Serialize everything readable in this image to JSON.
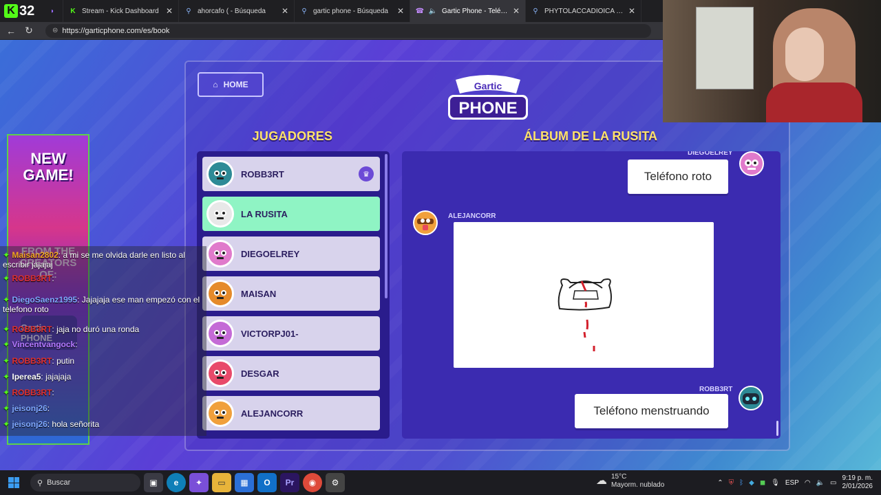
{
  "browser": {
    "kick_count": "32",
    "tabs": [
      {
        "title": "",
        "icon": "kick-icon",
        "closable": false
      },
      {
        "title": "Stream - Kick Dashboard",
        "icon": "kick-icon"
      },
      {
        "title": "ahorcafo ( - Búsqueda",
        "icon": "search-icon"
      },
      {
        "title": "gartic phone - Búsqueda",
        "icon": "search-icon"
      },
      {
        "title": "Gartic Phone - Teléfono De",
        "icon": "gartic-icon",
        "active": true
      },
      {
        "title": "PHYTOLACCADIOICA - Búsque",
        "icon": "search-icon"
      }
    ],
    "url": "https://garticphone.com/es/book"
  },
  "game": {
    "home_label": "HOME",
    "logo_line1": "Gartic",
    "logo_line2": "PHONE",
    "players_title": "JUGADORES",
    "album_title": "ÁLBUM DE LA RUSITA",
    "players": [
      {
        "name": "ROBB3RT",
        "host": true,
        "avatar_color": "#2d8a96"
      },
      {
        "name": "LA RUSITA",
        "me": true,
        "avatar_color": "#e8e8e8"
      },
      {
        "name": "DIEGOELREY",
        "avatar_color": "#e07acb"
      },
      {
        "name": "MAISAN",
        "avatar_color": "#e58a2a"
      },
      {
        "name": "VICTORPJ01-",
        "avatar_color": "#c46ad6"
      },
      {
        "name": "DESGAR",
        "avatar_color": "#e84a6a"
      },
      {
        "name": "ALEJANCORR",
        "avatar_color": "#f0a03c"
      }
    ],
    "album": {
      "entry1_user": "DIEGOELREY",
      "entry1_text": "Teléfono roto",
      "entry2_user": "ALEJANCORR",
      "entry3_user": "ROBB3RT",
      "entry3_text": "Teléfono menstruando"
    }
  },
  "chat": [
    {
      "user": "Maisan2802",
      "text": ": a mi se me olvida darle en listo al escribir jajajaj",
      "color": "#f5a623"
    },
    {
      "user": "ROBB3RT",
      "text": ":",
      "color": "#e03030"
    },
    {
      "user": "DiegoSaenz1995",
      "text": ": Jajajaja ese man empezó con el telefono roto",
      "color": "#7fa8ff"
    },
    {
      "user": "ROBB3RT",
      "text": ": jaja no duró una ronda",
      "color": "#e03030"
    },
    {
      "user": "Vincentvangock",
      "text": ":",
      "color": "#b478ff"
    },
    {
      "user": "ROBB3RT",
      "text": ": putin",
      "color": "#e03030"
    },
    {
      "user": "Iperea5",
      "text": ": jajajaja",
      "color": "#ffffff"
    },
    {
      "user": "ROBB3RT",
      "text": ":",
      "color": "#e03030"
    },
    {
      "user": "jeisonj26",
      "text": ":",
      "color": "#7fa8ff"
    },
    {
      "user": "jeisonj26",
      "text": ": hola señorita",
      "color": "#7fa8ff"
    }
  ],
  "promo": {
    "line1": "NEW",
    "line2": "GAME!",
    "line3": "FROM THE",
    "line4": "CREATORS",
    "line5": "OF:",
    "brand": "Gartic PHONE"
  },
  "taskbar": {
    "search_placeholder": "Buscar",
    "weather_temp": "15°C",
    "weather_desc": "Mayorm. nublado",
    "lang": "ESP",
    "time": "9:19 p. m.",
    "date": "2/01/2026"
  }
}
